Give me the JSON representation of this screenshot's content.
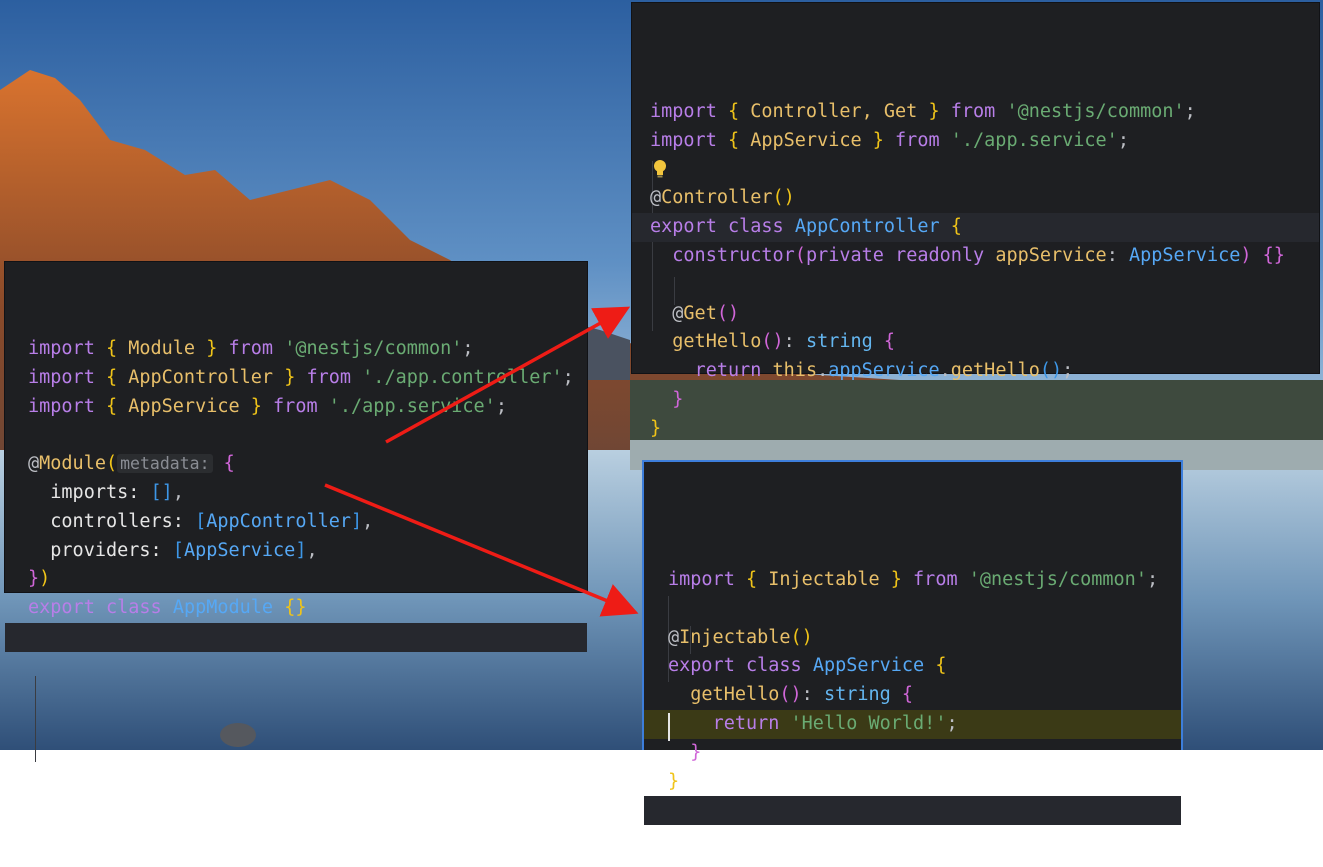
{
  "colors": {
    "arrow": "#ee1c16",
    "editor_bg": "#1e1f22",
    "focused_border": "#3d7edb",
    "warning_highlight": "#3b3a16"
  },
  "module_file": {
    "lines": [
      [
        {
          "t": "import",
          "c": "kwv"
        },
        {
          "t": " "
        },
        {
          "t": "{",
          "c": "br1"
        },
        {
          "t": " Module ",
          "c": "fn"
        },
        {
          "t": "}",
          "c": "br1"
        },
        {
          "t": " "
        },
        {
          "t": "from",
          "c": "kwv"
        },
        {
          "t": " "
        },
        {
          "t": "'@nestjs/common'",
          "c": "str"
        },
        {
          "t": ";"
        }
      ],
      [
        {
          "t": "import",
          "c": "kwv"
        },
        {
          "t": " "
        },
        {
          "t": "{",
          "c": "br1"
        },
        {
          "t": " AppController ",
          "c": "fn"
        },
        {
          "t": "}",
          "c": "br1"
        },
        {
          "t": " "
        },
        {
          "t": "from",
          "c": "kwv"
        },
        {
          "t": " "
        },
        {
          "t": "'./app.controller'",
          "c": "str"
        },
        {
          "t": ";"
        }
      ],
      [
        {
          "t": "import",
          "c": "kwv"
        },
        {
          "t": " "
        },
        {
          "t": "{",
          "c": "br1"
        },
        {
          "t": " AppService ",
          "c": "fn"
        },
        {
          "t": "}",
          "c": "br1"
        },
        {
          "t": " "
        },
        {
          "t": "from",
          "c": "kwv"
        },
        {
          "t": " "
        },
        {
          "t": "'./app.service'",
          "c": "str"
        },
        {
          "t": ";"
        }
      ],
      [],
      [
        {
          "t": "@",
          "c": "id"
        },
        {
          "t": "Module",
          "c": "dec"
        },
        {
          "t": "(",
          "c": "br1"
        },
        {
          "t": "metadata:",
          "c": "hint"
        },
        {
          "t": " "
        },
        {
          "t": "{",
          "c": "br2"
        }
      ],
      [
        {
          "t": "  imports: ",
          "c": "id2"
        },
        {
          "t": "[]",
          "c": "br3"
        },
        {
          "t": ","
        }
      ],
      [
        {
          "t": "  controllers: ",
          "c": "id2"
        },
        {
          "t": "[",
          "c": "br3"
        },
        {
          "t": "AppController",
          "c": "cls"
        },
        {
          "t": "]",
          "c": "br3"
        },
        {
          "t": ","
        }
      ],
      [
        {
          "t": "  providers: ",
          "c": "id2"
        },
        {
          "t": "[",
          "c": "br3"
        },
        {
          "t": "AppService",
          "c": "cls"
        },
        {
          "t": "]",
          "c": "br3"
        },
        {
          "t": ","
        }
      ],
      [
        {
          "t": "}",
          "c": "br2"
        },
        {
          "t": ")",
          "c": "br1"
        }
      ],
      [
        {
          "t": "export",
          "c": "kwv"
        },
        {
          "t": " "
        },
        {
          "t": "class",
          "c": "kwv"
        },
        {
          "t": " "
        },
        {
          "t": "AppModule",
          "c": "cls"
        },
        {
          "t": " "
        },
        {
          "t": "{}",
          "c": "br1"
        }
      ],
      []
    ]
  },
  "controller_file": {
    "lines": [
      [
        {
          "t": "import",
          "c": "kwv"
        },
        {
          "t": " "
        },
        {
          "t": "{",
          "c": "br1"
        },
        {
          "t": " Controller, Get ",
          "c": "fn"
        },
        {
          "t": "}",
          "c": "br1"
        },
        {
          "t": " "
        },
        {
          "t": "from",
          "c": "kwv"
        },
        {
          "t": " "
        },
        {
          "t": "'@nestjs/common'",
          "c": "str"
        },
        {
          "t": ";"
        }
      ],
      [
        {
          "t": "import",
          "c": "kwv"
        },
        {
          "t": " "
        },
        {
          "t": "{",
          "c": "br1"
        },
        {
          "t": " AppService ",
          "c": "fn"
        },
        {
          "t": "}",
          "c": "br1"
        },
        {
          "t": " "
        },
        {
          "t": "from",
          "c": "kwv"
        },
        {
          "t": " "
        },
        {
          "t": "'./app.service'",
          "c": "str"
        },
        {
          "t": ";"
        }
      ],
      [],
      [
        {
          "t": "@",
          "c": "id"
        },
        {
          "t": "Controller",
          "c": "dec"
        },
        {
          "t": "()",
          "c": "br1"
        }
      ],
      [
        {
          "t": "export",
          "c": "kwv"
        },
        {
          "t": " "
        },
        {
          "t": "class",
          "c": "kwv"
        },
        {
          "t": " "
        },
        {
          "t": "AppController",
          "c": "cls"
        },
        {
          "t": " "
        },
        {
          "t": "{",
          "c": "br1"
        }
      ],
      [
        {
          "t": "  "
        },
        {
          "t": "constructor",
          "c": "kwv"
        },
        {
          "t": "(",
          "c": "br2"
        },
        {
          "t": "private",
          "c": "kwv"
        },
        {
          "t": " "
        },
        {
          "t": "readonly",
          "c": "kwv"
        },
        {
          "t": " "
        },
        {
          "t": "appService",
          "c": "fn"
        },
        {
          "t": ": "
        },
        {
          "t": "AppService",
          "c": "cls"
        },
        {
          "t": ")",
          "c": "br2"
        },
        {
          "t": " "
        },
        {
          "t": "{}",
          "c": "br2"
        }
      ],
      [],
      [
        {
          "t": "  @",
          "c": "id"
        },
        {
          "t": "Get",
          "c": "dec"
        },
        {
          "t": "()",
          "c": "br2"
        }
      ],
      [
        {
          "t": "  "
        },
        {
          "t": "getHello",
          "c": "fn"
        },
        {
          "t": "()",
          "c": "br2"
        },
        {
          "t": ": "
        },
        {
          "t": "string",
          "c": "typ"
        },
        {
          "t": " "
        },
        {
          "t": "{",
          "c": "br2"
        }
      ],
      [
        {
          "t": "    "
        },
        {
          "t": "return",
          "c": "kwv"
        },
        {
          "t": " "
        },
        {
          "t": "this",
          "c": "fn"
        },
        {
          "t": "."
        },
        {
          "t": "appService",
          "c": "cls"
        },
        {
          "t": "."
        },
        {
          "t": "getHello",
          "c": "fn"
        },
        {
          "t": "()",
          "c": "br3"
        },
        {
          "t": ";"
        }
      ],
      [
        {
          "t": "  "
        },
        {
          "t": "}",
          "c": "br2"
        }
      ],
      [
        {
          "t": "}",
          "c": "br1"
        }
      ]
    ]
  },
  "service_file": {
    "lines": [
      [
        {
          "t": "import",
          "c": "kwv"
        },
        {
          "t": " "
        },
        {
          "t": "{",
          "c": "br1"
        },
        {
          "t": " Injectable ",
          "c": "fn"
        },
        {
          "t": "}",
          "c": "br1"
        },
        {
          "t": " "
        },
        {
          "t": "from",
          "c": "kwv"
        },
        {
          "t": " "
        },
        {
          "t": "'@nestjs/common'",
          "c": "str"
        },
        {
          "t": ";"
        }
      ],
      [],
      [
        {
          "t": "@",
          "c": "id"
        },
        {
          "t": "Injectable",
          "c": "dec"
        },
        {
          "t": "()",
          "c": "br1"
        }
      ],
      [
        {
          "t": "export",
          "c": "kwv"
        },
        {
          "t": " "
        },
        {
          "t": "class",
          "c": "kwv"
        },
        {
          "t": " "
        },
        {
          "t": "AppService",
          "c": "cls"
        },
        {
          "t": " "
        },
        {
          "t": "{",
          "c": "br1"
        }
      ],
      [
        {
          "t": "  "
        },
        {
          "t": "getHello",
          "c": "fn"
        },
        {
          "t": "()",
          "c": "br2"
        },
        {
          "t": ": "
        },
        {
          "t": "string",
          "c": "typ"
        },
        {
          "t": " "
        },
        {
          "t": "{",
          "c": "br2"
        }
      ],
      [
        {
          "t": "    "
        },
        {
          "t": "return",
          "c": "kwv"
        },
        {
          "t": " "
        },
        {
          "t": "'Hello World!'",
          "c": "str"
        },
        {
          "t": ";"
        }
      ],
      [
        {
          "t": "  "
        },
        {
          "t": "}",
          "c": "br2"
        }
      ],
      [
        {
          "t": "}",
          "c": "br1"
        }
      ],
      []
    ]
  },
  "icons": {
    "lightbulb": "lightbulb-icon"
  }
}
